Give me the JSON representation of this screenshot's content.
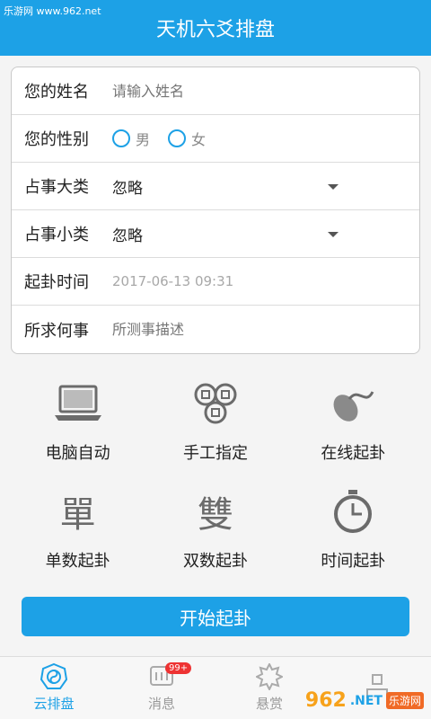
{
  "watermark": {
    "top_left": "乐游网 www.962.net",
    "br_num": "962",
    "br_net": ".NET",
    "br_cn": "乐游网"
  },
  "header": {
    "title": "天机六爻排盘"
  },
  "form": {
    "name": {
      "label": "您的姓名",
      "placeholder": "请输入姓名"
    },
    "gender": {
      "label": "您的性别",
      "male": "男",
      "female": "女"
    },
    "major": {
      "label": "占事大类",
      "value": "忽略"
    },
    "minor": {
      "label": "占事小类",
      "value": "忽略"
    },
    "time": {
      "label": "起卦时间",
      "value": "2017-06-13 09:31"
    },
    "matter": {
      "label": "所求何事",
      "placeholder": "所测事描述"
    }
  },
  "methods": [
    {
      "label": "电脑自动",
      "icon": "laptop-icon"
    },
    {
      "label": "手工指定",
      "icon": "coins-icon"
    },
    {
      "label": "在线起卦",
      "icon": "mouse-icon"
    },
    {
      "label": "单数起卦",
      "icon": "dan-char-icon",
      "glyph": "單"
    },
    {
      "label": "双数起卦",
      "icon": "shuang-char-icon",
      "glyph": "雙"
    },
    {
      "label": "时间起卦",
      "icon": "stopwatch-icon"
    }
  ],
  "start_button": "开始起卦",
  "tabs": [
    {
      "label": "云排盘",
      "icon": "yinyang-icon"
    },
    {
      "label": "消息",
      "icon": "message-icon",
      "badge": "99+"
    },
    {
      "label": "悬赏",
      "icon": "reward-icon"
    },
    {
      "label": "",
      "icon": "profile-icon"
    }
  ],
  "colors": {
    "accent": "#1da1e6"
  }
}
